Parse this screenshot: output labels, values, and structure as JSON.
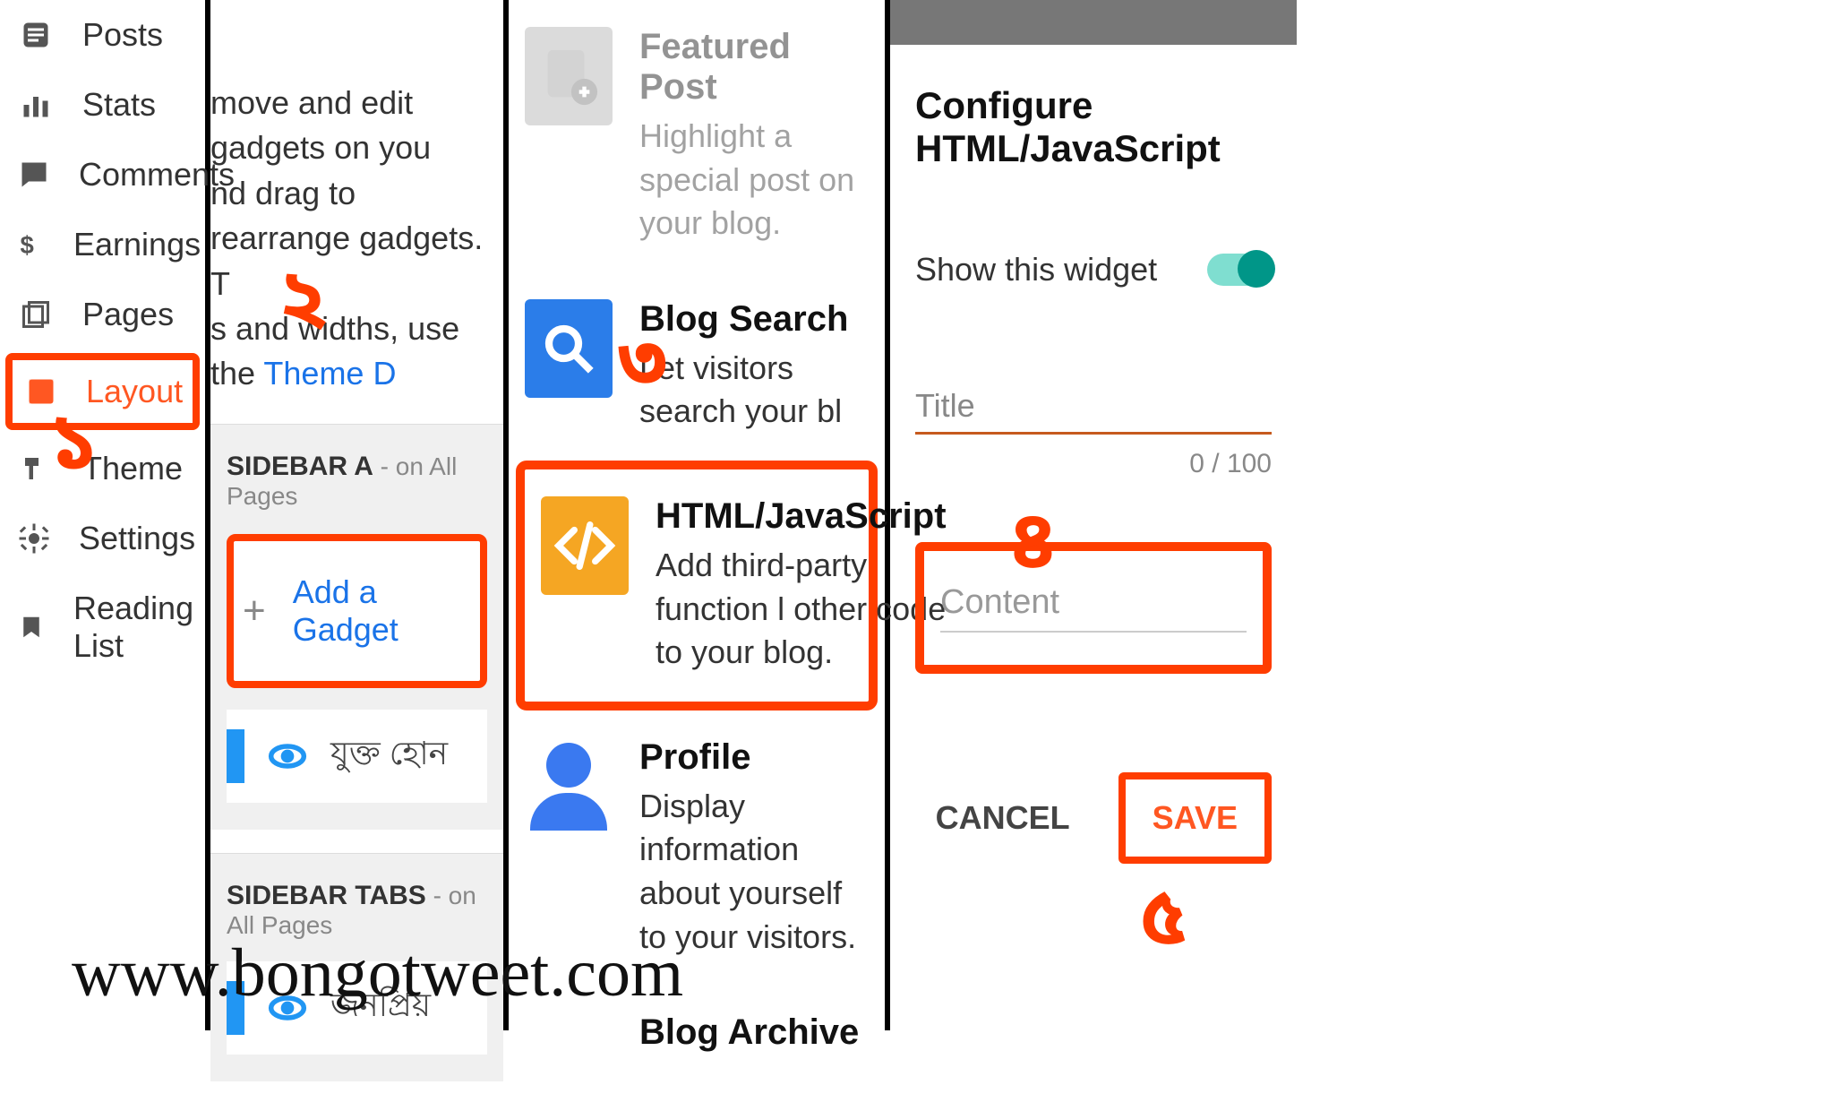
{
  "ann": {
    "one": "১",
    "two": "২",
    "three": "৩",
    "four": "৪",
    "five": "৫"
  },
  "watermark": "www.bongotweet.com",
  "nav": {
    "posts": "Posts",
    "stats": "Stats",
    "comments": "Comments",
    "earnings": "Earnings",
    "pages": "Pages",
    "layout": "Layout",
    "theme": "Theme",
    "settings": "Settings",
    "reading": "Reading List"
  },
  "layoutPanel": {
    "hint_l1": "move and edit gadgets on you",
    "hint_l2": "nd drag to rearrange gadgets. T",
    "hint_l3": "s and widths, use the ",
    "hint_link": "Theme D",
    "sidebarA": "SIDEBAR A",
    "sidebarTabs": "SIDEBAR TABS",
    "onAll": " - on All Pages",
    "addGadget": "Add a Gadget",
    "widget1": "যুক্ত হোন",
    "widget2": "জনপ্রিয়"
  },
  "gadgets": {
    "featured": {
      "title": "Featured Post",
      "desc": "Highlight a special post on your blog."
    },
    "search": {
      "title": "Blog Search",
      "desc": "Let visitors search your bl"
    },
    "html": {
      "title": "HTML/JavaScript",
      "desc": "Add third-party function l other code to your blog."
    },
    "profile": {
      "title": "Profile",
      "desc": "Display information about yourself to your visitors."
    },
    "archive": {
      "title": "Blog Archive"
    }
  },
  "dialog": {
    "title": "Configure HTML/JavaScript",
    "showWidget": "Show this widget",
    "titleLabel": "Title",
    "counter": "0 / 100",
    "contentLabel": "Content",
    "cancel": "CANCEL",
    "save": "SAVE"
  }
}
